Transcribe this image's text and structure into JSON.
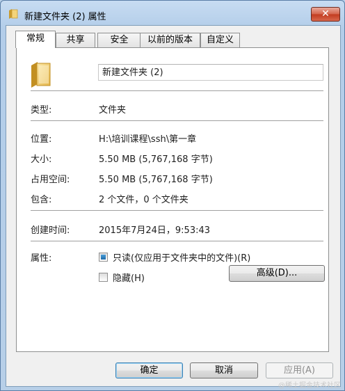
{
  "window": {
    "title": "新建文件夹 (2) 属性",
    "close_glyph": "✕"
  },
  "tabs": [
    {
      "label": "常规",
      "active": true
    },
    {
      "label": "共享",
      "active": false
    },
    {
      "label": "安全",
      "active": false
    },
    {
      "label": "以前的版本",
      "active": false
    },
    {
      "label": "自定义",
      "active": false
    }
  ],
  "general": {
    "folder_name": "新建文件夹 (2)",
    "type_label": "类型:",
    "type_value": "文件夹",
    "location_label": "位置:",
    "location_value": "H:\\培训课程\\ssh\\第一章",
    "size_label": "大小:",
    "size_value": "5.50 MB (5,767,168 字节)",
    "disk_size_label": "占用空间:",
    "disk_size_value": "5.50 MB (5,767,168 字节)",
    "contains_label": "包含:",
    "contains_value": "2 个文件，0 个文件夹",
    "created_label": "创建时间:",
    "created_value": "2015年7月24日，9:53:43",
    "attributes_label": "属性:",
    "readonly_label": "只读(仅应用于文件夹中的文件)(R)",
    "readonly_state": "partial",
    "hidden_label": "隐藏(H)",
    "hidden_checked": false,
    "advanced_button": "高级(D)..."
  },
  "footer": {
    "ok": "确定",
    "cancel": "取消",
    "apply": "应用(A)"
  },
  "watermark": "@稀土掘金技术社区",
  "icons": {
    "title": "folder-icon",
    "main": "folder-icon"
  },
  "colors": {
    "accent": "#3c7fb1",
    "window_frame": "#b9d1ea",
    "close": "#c23b1f"
  }
}
